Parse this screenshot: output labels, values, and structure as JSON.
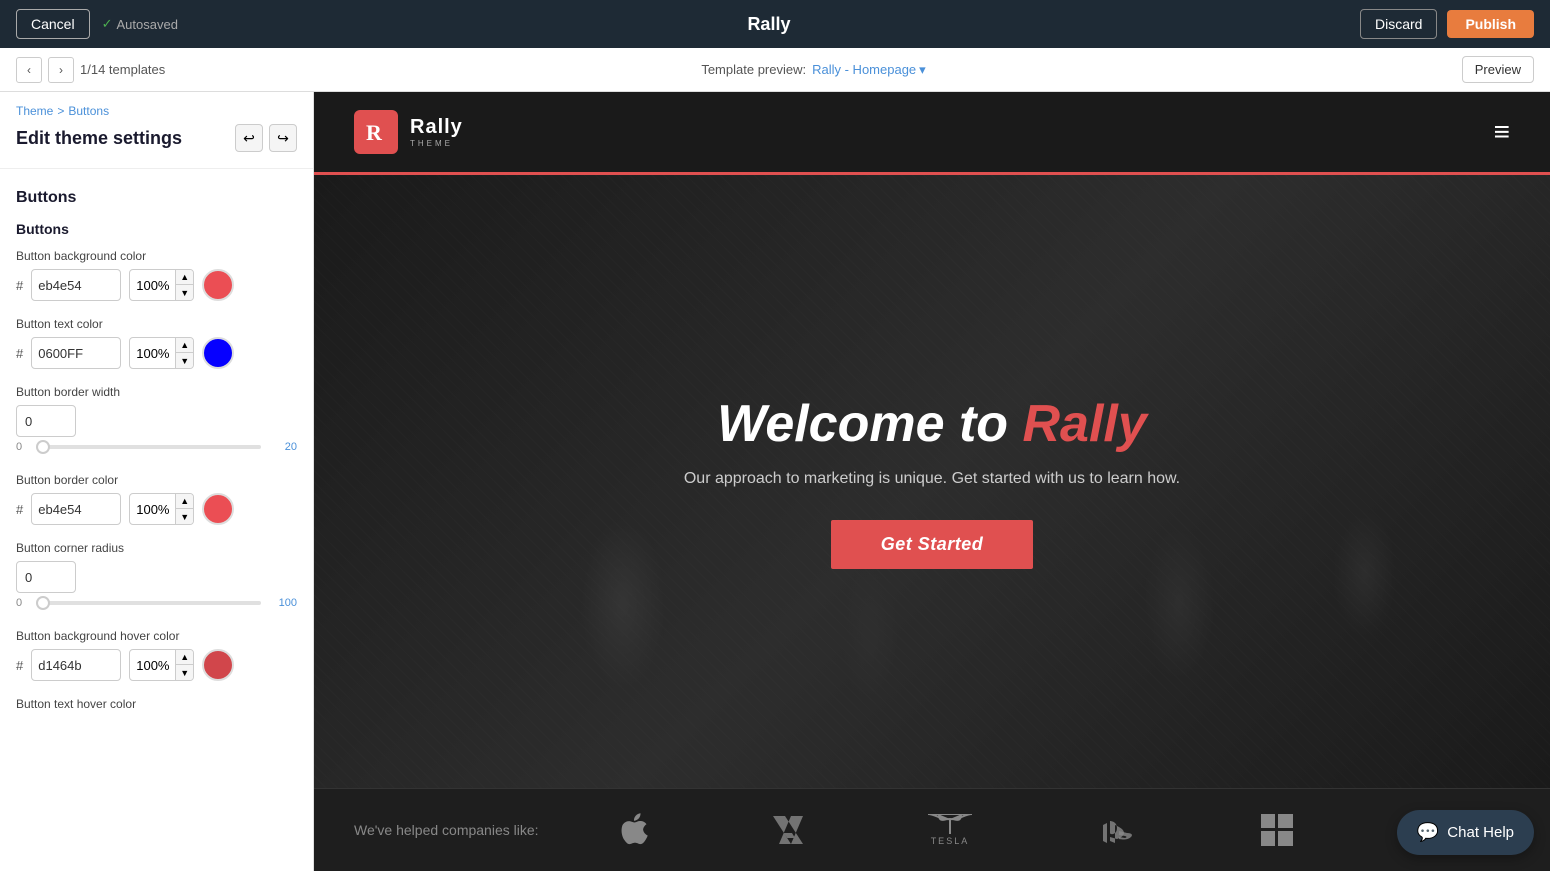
{
  "topbar": {
    "cancel_label": "Cancel",
    "autosaved_label": "Autosaved",
    "title": "Rally",
    "discard_label": "Discard",
    "publish_label": "Publish"
  },
  "templatebar": {
    "count": "1/14 templates",
    "preview_prefix": "Template preview:",
    "template_name": "Rally - Homepage",
    "preview_label": "Preview"
  },
  "sidebar": {
    "breadcrumb_theme": "Theme",
    "breadcrumb_sep": ">",
    "breadcrumb_buttons": "Buttons",
    "edit_title": "Edit theme settings",
    "section_heading": "Buttons",
    "subsection_heading": "Buttons",
    "fields": {
      "bg_color_label": "Button background color",
      "bg_color_hex": "eb4e54",
      "bg_color_opacity": "100%",
      "text_color_label": "Button text color",
      "text_color_hex": "0600FF",
      "text_color_opacity": "100%",
      "border_width_label": "Button border width",
      "border_width_value": "0",
      "slider1_min": "0",
      "slider1_max": "20",
      "border_color_label": "Button border color",
      "border_color_hex": "eb4e54",
      "border_color_opacity": "100%",
      "corner_radius_label": "Button corner radius",
      "corner_radius_value": "0",
      "slider2_min": "0",
      "slider2_max": "100",
      "bg_hover_label": "Button background hover color",
      "bg_hover_hex": "d1464b",
      "bg_hover_opacity": "100%",
      "text_hover_label": "Button text hover color"
    }
  },
  "rally_preview": {
    "logo_icon": "R",
    "logo_text": "Rally",
    "logo_sub": "THEME",
    "hamburger": "≡",
    "hero_title_1": "Welcome to ",
    "hero_title_2": "Rally",
    "hero_subtitle": "Our approach to marketing is unique. Get started with us to learn how.",
    "cta_label": "Get Started",
    "footer_label": "We've helped companies like:"
  },
  "chat": {
    "label": "Chat Help",
    "icon": "💬"
  },
  "colors": {
    "bg_swatch": "#eb4e54",
    "text_swatch": "#0600FF",
    "border_swatch": "#eb4e54",
    "hover_swatch": "#d1464b",
    "accent_red": "#e05050",
    "accent_blue": "#4a90d9"
  }
}
